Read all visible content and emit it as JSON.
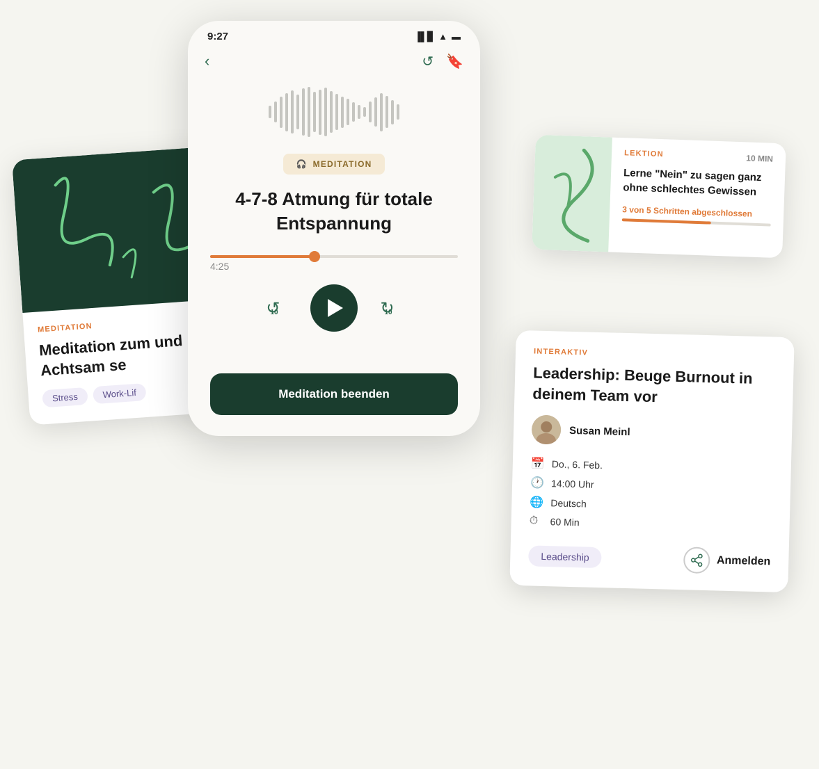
{
  "phone": {
    "time": "9:27",
    "back_icon": "‹",
    "history_icon": "↺",
    "bookmark_icon": "🔖",
    "badge": "MEDITATION",
    "title": "4-7-8 Atmung für totale Entspannung",
    "progress_time": "4:25",
    "end_button": "Meditation beenden"
  },
  "card_meditation": {
    "tag": "MEDITATION",
    "title": "Meditation zum und Achtsam se",
    "tags": [
      "Stress",
      "Work-Lif"
    ]
  },
  "card_lektion": {
    "tag": "LEKTION",
    "time": "10 MIN",
    "title": "Lerne \"Nein\" zu sagen ganz ohne schlechtes Gewissen",
    "progress_text": "3 von 5  Schritten abgeschlossen"
  },
  "card_interaktiv": {
    "tag": "INTERAKTIV",
    "title": "Leadership: Beuge Burnout in deinem Team vor",
    "author": "Susan Meinl",
    "date_icon": "📅",
    "date": "Do., 6. Feb.",
    "time_icon": "🕐",
    "time": "14:00 Uhr",
    "lang_icon": "🌐",
    "lang": "Deutsch",
    "duration_icon": "⏱",
    "duration": "60 Min",
    "tag_pill": "Leadership",
    "register_btn": "Anmelden"
  }
}
